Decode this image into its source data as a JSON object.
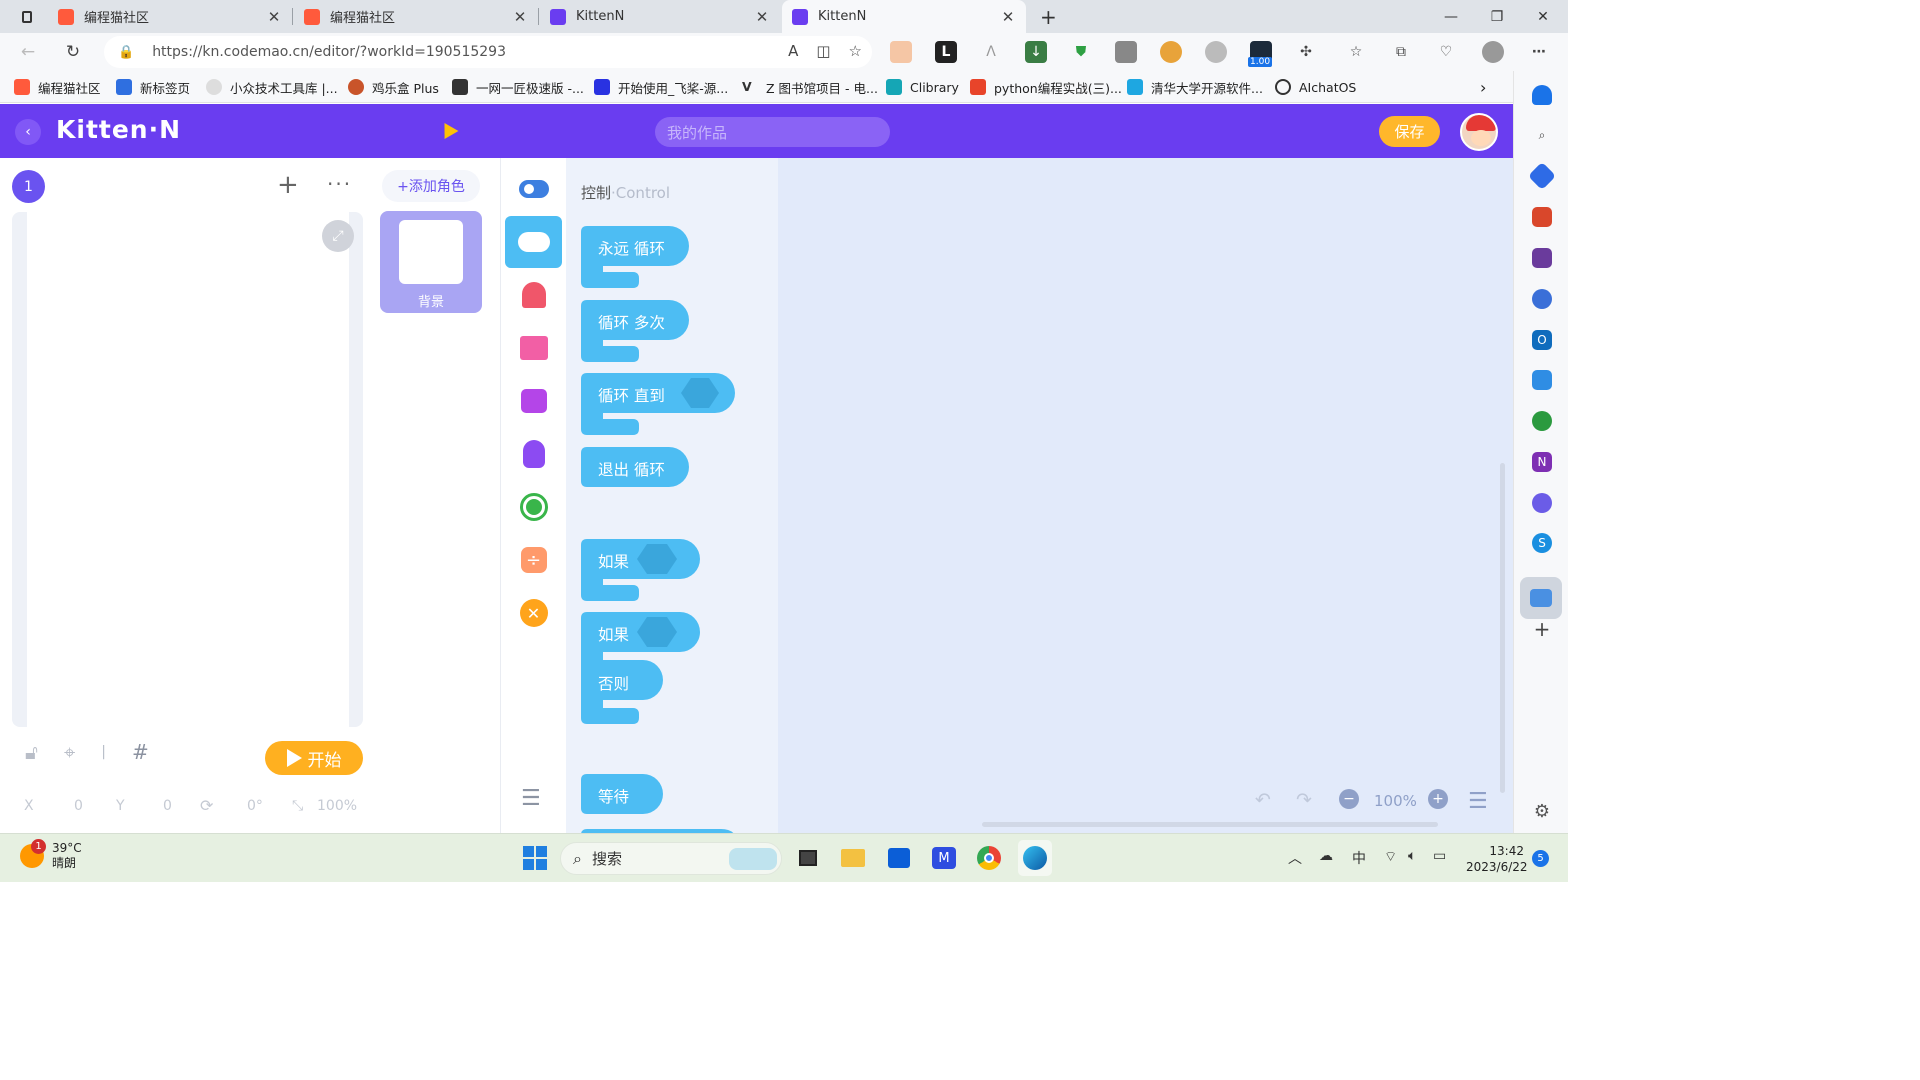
{
  "browser": {
    "tabs": [
      {
        "title": "编程猫社区",
        "active": false
      },
      {
        "title": "编程猫社区",
        "active": false
      },
      {
        "title": "KittenN",
        "active": false
      },
      {
        "title": "KittenN",
        "active": true
      }
    ],
    "new_tab_label": "+",
    "url_host": "https://kn.codemao.cn",
    "url_path": "/editor/?workId=190515293",
    "bookmarks": [
      "编程猫社区",
      "新标签页",
      "小众技术工具库 |...",
      "鸡乐盒 Plus",
      "一网一匠极速版 -...",
      "开始使用_飞桨-源...",
      "Z 图书馆项目 - 电...",
      "Clibrary",
      "python编程实战(三)...",
      "清华大学开源软件...",
      "AIchatOS"
    ],
    "extension_badge": "1.00"
  },
  "app": {
    "logo": "Kitten·N",
    "work_title_placeholder": "我的作品",
    "save_label": "保存",
    "scene_number": "1",
    "add_role_label": "+添加角色",
    "role_name": "背景",
    "start_label": "开始",
    "coords": {
      "x_label": "X",
      "x_val": "0",
      "y_label": "Y",
      "y_val": "0",
      "rotation": "0°",
      "scale": "100%"
    },
    "palette_title": "控制",
    "palette_title_en": "·Control",
    "blocks": [
      "永远 循环",
      "循环 多次",
      "循环 直到",
      "退出 循环",
      "如果",
      "如果",
      "否则",
      "等待"
    ],
    "zoom": "100%",
    "colors": {
      "header": "#6a3df0",
      "block": "#4dbdf3",
      "accent": "#ffb020"
    }
  },
  "taskbar": {
    "temperature": "39°C",
    "weather": "晴朗",
    "weather_badge": "1",
    "search_placeholder": "搜索",
    "ime": "中",
    "time": "13:42",
    "date": "2023/6/22",
    "notif_count": "5"
  }
}
